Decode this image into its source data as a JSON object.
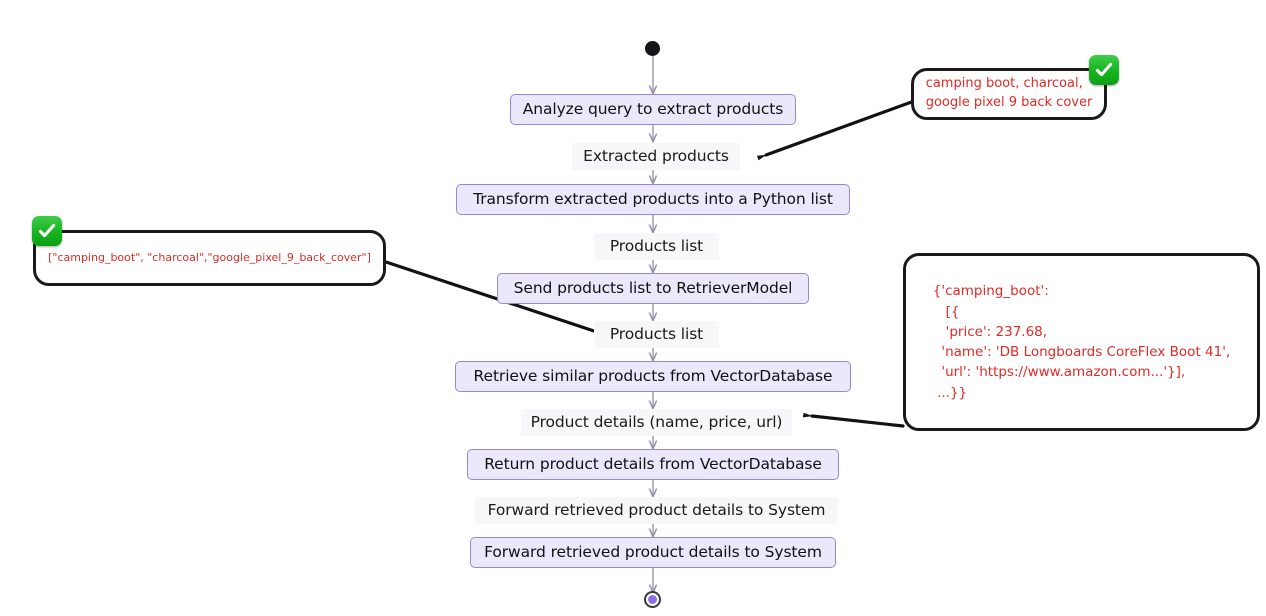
{
  "diagram": {
    "type": "flowchart",
    "title": "Product retrieval pipeline",
    "colors": {
      "node_fill": "#ECE8FB",
      "node_border": "#9A86D8",
      "edge_line": "#9A93A8",
      "annotation_text": "#E02A26",
      "annotation_border": "#1a1a1a",
      "badge_green": "#16B51E",
      "end_node_fill": "#8A6FE8"
    },
    "start_node": {
      "name": "start",
      "shape": "filled-circle"
    },
    "end_node": {
      "name": "end",
      "shape": "ringed-circle"
    },
    "nodes": [
      {
        "id": "n1",
        "label": "Analyze query to extract products"
      },
      {
        "id": "n2",
        "label": "Transform extracted products into a Python list"
      },
      {
        "id": "n3",
        "label": "Send products list to RetrieverModel"
      },
      {
        "id": "n4",
        "label": "Retrieve similar products from VectorDatabase"
      },
      {
        "id": "n5",
        "label": "Return product details from VectorDatabase"
      },
      {
        "id": "n6",
        "label": "Forward retrieved product details to System"
      }
    ],
    "edge_labels": [
      {
        "id": "e1",
        "label": "Extracted products"
      },
      {
        "id": "e2",
        "label": "Products list"
      },
      {
        "id": "e3",
        "label": "Products list"
      },
      {
        "id": "e4",
        "label": "Product details (name, price, url)"
      },
      {
        "id": "e5",
        "label": "Forward retrieved product details to System"
      }
    ],
    "annotations": [
      {
        "id": "a1",
        "target": "Extracted products",
        "has_check_badge": true,
        "badge_position": "top-right",
        "text": "camping boot, charcoal,\ngoogle pixel 9 back cover"
      },
      {
        "id": "a2",
        "target": "Products list",
        "has_check_badge": true,
        "badge_position": "top-left",
        "text": "[\"camping_boot\", \"charcoal\",\"google_pixel_9_back_cover\"]"
      },
      {
        "id": "a3",
        "target": "Product details (name, price, url)",
        "has_check_badge": false,
        "text": "{'camping_boot':\n   [{\n   'price': 237.68,\n  'name': 'DB Longboards CoreFlex Boot 41',\n  'url': 'https://www.amazon.com...'}],\n ...}}"
      }
    ]
  }
}
